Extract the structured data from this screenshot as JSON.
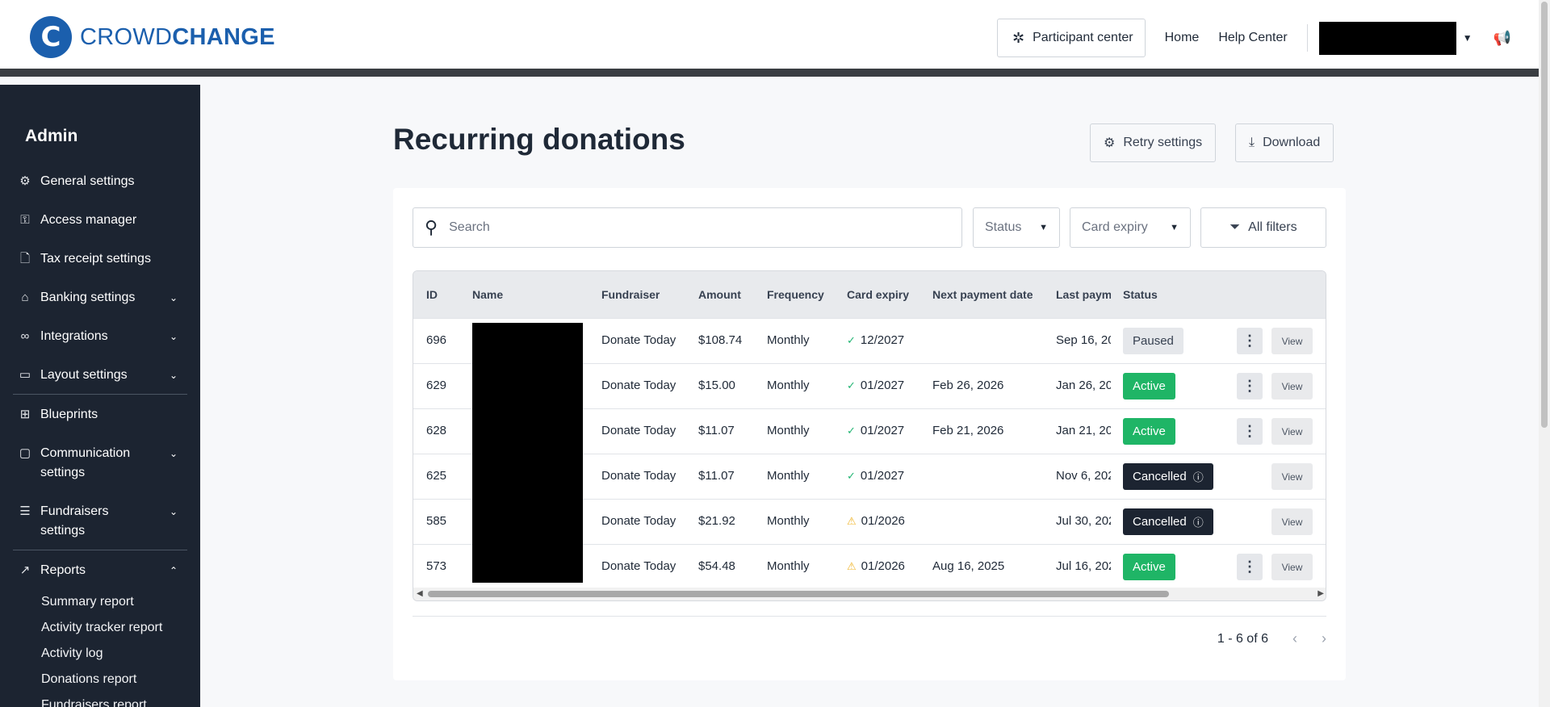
{
  "header": {
    "logo_mark": "C",
    "logo_text_light": "CROWD",
    "logo_text_bold": "CHANGE",
    "participant_center": "Participant center",
    "home": "Home",
    "help_center": "Help Center"
  },
  "sidebar": {
    "title": "Admin",
    "items": [
      {
        "label": "General settings",
        "icon": "gear-icon"
      },
      {
        "label": "Access manager",
        "icon": "key-icon"
      },
      {
        "label": "Tax receipt settings",
        "icon": "document-icon"
      },
      {
        "label": "Banking settings",
        "icon": "bank-icon"
      },
      {
        "label": "Integrations",
        "icon": "link-icon"
      },
      {
        "label": "Layout settings",
        "icon": "layout-icon"
      },
      {
        "label": "Blueprints",
        "icon": "blueprint-icon"
      },
      {
        "label": "Communication settings",
        "icon": "message-icon"
      },
      {
        "label": "Fundraisers settings",
        "icon": "sliders-icon"
      },
      {
        "label": "Reports",
        "icon": "chart-icon"
      }
    ],
    "report_items": [
      "Summary report",
      "Activity tracker report",
      "Activity log",
      "Donations report",
      "Fundraisers report"
    ]
  },
  "main": {
    "title": "Recurring donations",
    "retry_settings": "Retry settings",
    "download": "Download",
    "search_placeholder": "Search",
    "status_filter": "Status",
    "card_expiry_filter": "Card expiry",
    "all_filters": "All filters",
    "columns": [
      "ID",
      "Name",
      "Fundraiser",
      "Amount",
      "Frequency",
      "Card expiry",
      "Next payment date",
      "Last paym",
      "Status"
    ],
    "rows": [
      {
        "id": "696",
        "fundraiser": "Donate Today",
        "amount": "$108.74",
        "frequency": "Monthly",
        "expiry": "12/2027",
        "next": "",
        "last": "Sep 16, 20",
        "status": "Paused"
      },
      {
        "id": "629",
        "fundraiser": "Donate Today",
        "amount": "$15.00",
        "frequency": "Monthly",
        "expiry": "01/2027",
        "next": "Feb 26, 2026",
        "last": "Jan 26, 20",
        "status": "Active"
      },
      {
        "id": "628",
        "fundraiser": "Donate Today",
        "amount": "$11.07",
        "frequency": "Monthly",
        "expiry": "01/2027",
        "next": "Feb 21, 2026",
        "last": "Jan 21, 20",
        "status": "Active"
      },
      {
        "id": "625",
        "fundraiser": "Donate Today",
        "amount": "$11.07",
        "frequency": "Monthly",
        "expiry": "01/2027",
        "next": "",
        "last": "Nov 6, 202",
        "status": "Cancelled"
      },
      {
        "id": "585",
        "fundraiser": "Donate Today",
        "amount": "$21.92",
        "frequency": "Monthly",
        "expiry": "01/2026",
        "next": "",
        "last": "Jul 30, 202",
        "status": "Cancelled"
      },
      {
        "id": "573",
        "fundraiser": "Donate Today",
        "amount": "$54.48",
        "frequency": "Monthly",
        "expiry": "01/2026",
        "next": "Aug 16, 2025",
        "last": "Jul 16, 202",
        "status": "Active"
      }
    ],
    "view_label": "View",
    "pagination": "1 - 6 of 6"
  },
  "colors": {
    "brand": "#1b5fad",
    "sidebar_bg": "#1c2431",
    "active": "#1fb566",
    "warning": "#f0b429"
  }
}
